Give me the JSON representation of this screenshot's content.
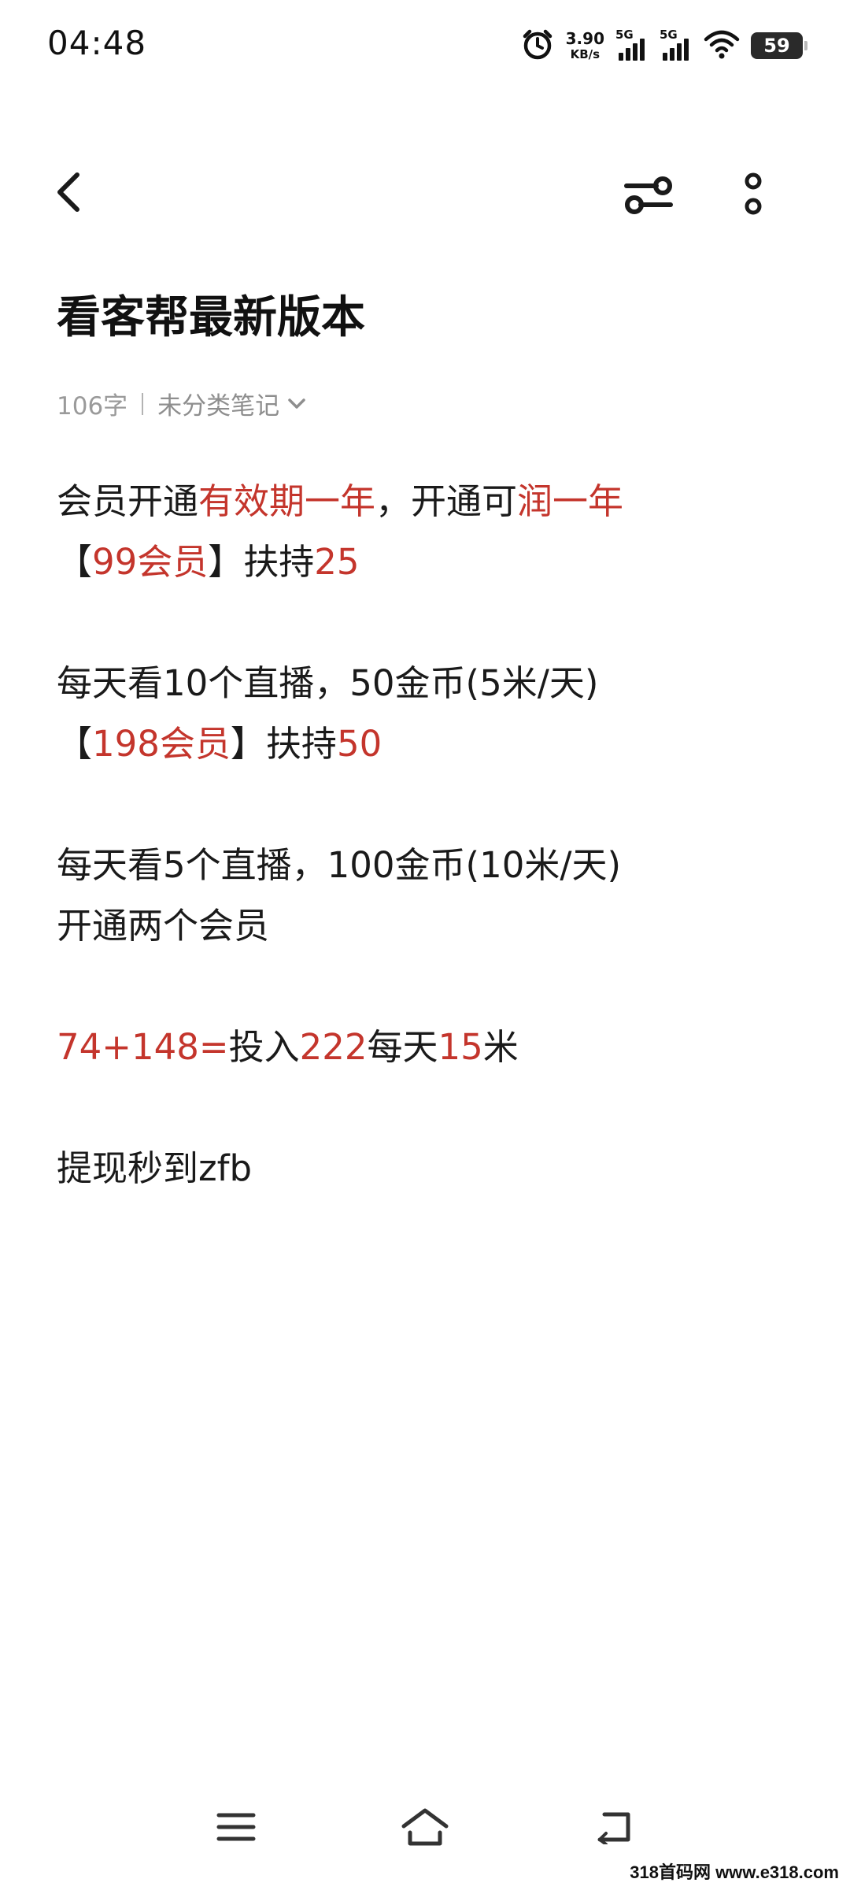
{
  "status_bar": {
    "time": "04:48",
    "net_speed_value": "3.90",
    "net_speed_unit": "KB/s",
    "sim1_label": "5G",
    "sim2_label": "5G",
    "battery_level": "59",
    "icons": [
      "alarm-icon",
      "signal-icon",
      "wifi-icon",
      "battery-icon"
    ]
  },
  "toolbar": {
    "back_icon": "chevron-left-icon",
    "format_icon": "text-format-icon",
    "more_icon": "more-vertical-icon"
  },
  "note": {
    "title": "看客帮最新版本",
    "word_count": "106字",
    "category": "未分类笔记"
  },
  "body": {
    "line1": {
      "a": "会员开通",
      "b": "有效期一年",
      "c": "，开通可",
      "d": "润一年"
    },
    "line2": {
      "a": "【",
      "b": "99会员",
      "c": "】扶持",
      "d": "25"
    },
    "line3": {
      "a": "每天看10个直播，50金币(5米/天)"
    },
    "line4": {
      "a": "【",
      "b": "198会员",
      "c": "】扶持",
      "d": "50"
    },
    "line5": {
      "a": "每天看5个直播，100金币(10米/天)"
    },
    "line6": {
      "a": "开通两个会员"
    },
    "line7": {
      "a": "74+148=",
      "b": "投入",
      "c": "222",
      "d": "每天",
      "e": "15",
      "f": "米"
    },
    "line8": {
      "a": "提现秒到zfb"
    }
  },
  "nav_bar": {
    "icons": [
      "menu-icon",
      "home-icon",
      "back-icon"
    ]
  },
  "watermark": "318首码网 www.e318.com",
  "colors": {
    "accent_red": "#c4352c",
    "text": "#1a1a1a",
    "meta_gray": "#9a9a9a"
  }
}
